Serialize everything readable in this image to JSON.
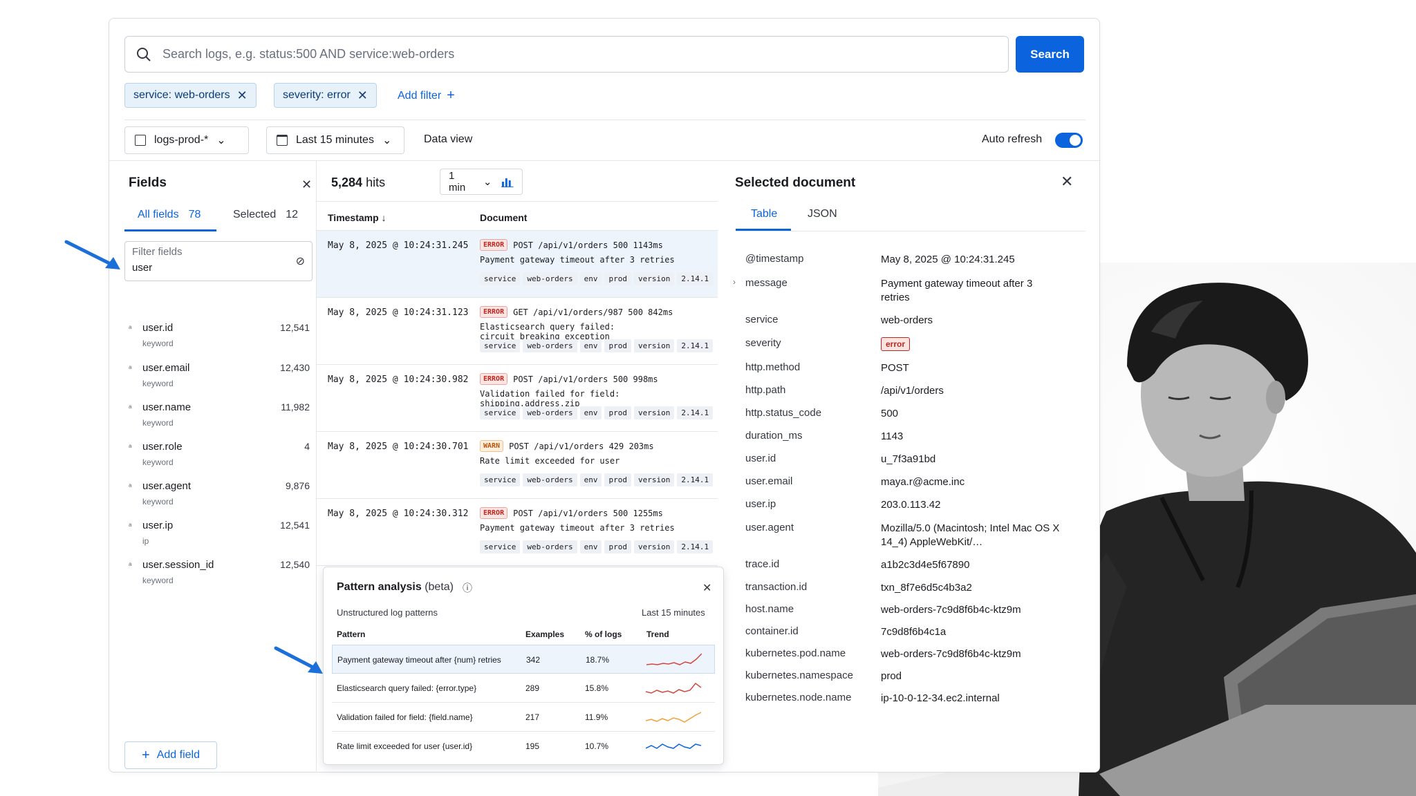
{
  "search": {
    "placeholder": "Search logs, e.g. status:500 AND service:web-orders",
    "button": "Search"
  },
  "filters": [
    {
      "label": "service: web-orders"
    },
    {
      "label": "severity: error"
    }
  ],
  "add_filter": "Add filter",
  "toolbar": {
    "index": "logs-prod-*",
    "time_range": "Last 15 minutes",
    "data_view": "Data view",
    "auto_refresh": "Auto refresh"
  },
  "fields_panel": {
    "title": "Fields",
    "tab_all": "All fields",
    "tab_all_count": "78",
    "tab_selected": "Selected",
    "tab_selected_count": "12",
    "filter_label": "Filter fields",
    "filter_value": "user",
    "items": [
      {
        "name": "user.id",
        "type": "keyword",
        "count": "12,541"
      },
      {
        "name": "user.email",
        "type": "keyword",
        "count": "12,430"
      },
      {
        "name": "user.name",
        "type": "keyword",
        "count": "11,982"
      },
      {
        "name": "user.role",
        "type": "keyword",
        "count": "4"
      },
      {
        "name": "user.agent",
        "type": "keyword",
        "count": "9,876"
      },
      {
        "name": "user.ip",
        "type": "ip",
        "count": "12,541"
      },
      {
        "name": "user.session_id",
        "type": "keyword",
        "count": "12,540"
      }
    ],
    "add_field": "Add field"
  },
  "hits": {
    "count": "5,284",
    "unit": "hits",
    "interval": "1 min"
  },
  "columns": {
    "timestamp": "Timestamp",
    "document": "Document"
  },
  "logs": [
    {
      "ts": "May 8, 2025 @ 10:24:31.245",
      "level": "ERROR",
      "request": "POST /api/v1/orders 500 1143ms",
      "message": "Payment gateway timeout after 3 retries",
      "service": "web-orders",
      "env": "prod",
      "version": "2.14.1"
    },
    {
      "ts": "May 8, 2025 @ 10:24:31.123",
      "level": "ERROR",
      "request": "GET /api/v1/orders/987 500 842ms",
      "message": "Elasticsearch query failed: circuit_breaking_exception",
      "service": "web-orders",
      "env": "prod",
      "version": "2.14.1"
    },
    {
      "ts": "May 8, 2025 @ 10:24:30.982",
      "level": "ERROR",
      "request": "POST /api/v1/orders 500 998ms",
      "message": "Validation failed for field: shipping.address.zip",
      "service": "web-orders",
      "env": "prod",
      "version": "2.14.1"
    },
    {
      "ts": "May 8, 2025 @ 10:24:30.701",
      "level": "WARN",
      "request": "POST /api/v1/orders 429 203ms",
      "message": "Rate limit exceeded for user",
      "service": "web-orders",
      "env": "prod",
      "version": "2.14.1"
    },
    {
      "ts": "May 8, 2025 @ 10:24:30.312",
      "level": "ERROR",
      "request": "POST /api/v1/orders 500 1255ms",
      "message": "Payment gateway timeout after 3 retries",
      "service": "web-orders",
      "env": "prod",
      "version": "2.14.1"
    }
  ],
  "tag_labels": {
    "service": "service",
    "env": "env",
    "version": "version"
  },
  "pattern_analysis": {
    "title": "Pattern analysis",
    "beta": "(beta)",
    "subtitle": "Unstructured log patterns",
    "range": "Last 15 minutes",
    "headers": {
      "pattern": "Pattern",
      "examples": "Examples",
      "pct": "% of logs",
      "trend": "Trend"
    },
    "rows": [
      {
        "pattern": "Payment gateway timeout after {num} retries",
        "examples": "342",
        "pct": "18.7%",
        "trend_color": "#d6453d"
      },
      {
        "pattern": "Elasticsearch query failed: {error.type}",
        "examples": "289",
        "pct": "15.8%",
        "trend_color": "#d6453d"
      },
      {
        "pattern": "Validation failed for field: {field.name}",
        "examples": "217",
        "pct": "11.9%",
        "trend_color": "#f5a035"
      },
      {
        "pattern": "Rate limit exceeded for user {user.id}",
        "examples": "195",
        "pct": "10.7%",
        "trend_color": "#0b64dd"
      }
    ]
  },
  "document": {
    "title": "Selected document",
    "tab_table": "Table",
    "tab_json": "JSON",
    "fields": [
      {
        "k": "@timestamp",
        "v": "May 8, 2025 @ 10:24:31.245"
      },
      {
        "k": "message",
        "v": "Payment gateway timeout after 3 retries"
      },
      {
        "k": "service",
        "v": "web-orders"
      },
      {
        "k": "severity",
        "v": "error"
      },
      {
        "k": "http.method",
        "v": "POST"
      },
      {
        "k": "http.path",
        "v": "/api/v1/orders"
      },
      {
        "k": "http.status_code",
        "v": "500"
      },
      {
        "k": "duration_ms",
        "v": "1143"
      },
      {
        "k": "user.id",
        "v": "u_7f3a91bd"
      },
      {
        "k": "user.email",
        "v": "maya.r@acme.inc"
      },
      {
        "k": "user.ip",
        "v": "203.0.113.42"
      },
      {
        "k": "user.agent",
        "v": "Mozilla/5.0 (Macintosh; Intel Mac OS X 14_4) AppleWebKit/…"
      },
      {
        "k": "trace.id",
        "v": "a1b2c3d4e5f67890"
      },
      {
        "k": "transaction.id",
        "v": "txn_8f7e6d5c4b3a2"
      },
      {
        "k": "host.name",
        "v": "web-orders-7c9d8f6b4c-ktz9m"
      },
      {
        "k": "container.id",
        "v": "7c9d8f6b4c1a"
      },
      {
        "k": "kubernetes.pod.name",
        "v": "web-orders-7c9d8f6b4c-ktz9m"
      },
      {
        "k": "kubernetes.namespace",
        "v": "prod"
      },
      {
        "k": "kubernetes.node.name",
        "v": "ip-10-0-12-34.ec2.internal"
      }
    ]
  },
  "colors": {
    "accent": "#0b64dd",
    "error": "#bd271e",
    "warn": "#b5560b"
  }
}
